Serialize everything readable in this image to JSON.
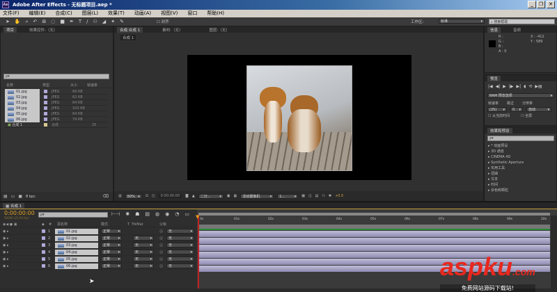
{
  "app": {
    "title": "Adobe After Effects - 无标题项目.aep *",
    "logo": "Ae",
    "min": "_",
    "max": "❐",
    "close": "✕"
  },
  "menu": [
    "文件(F)",
    "编辑(E)",
    "合成(C)",
    "图层(L)",
    "效果(T)",
    "动画(A)",
    "视图(V)",
    "窗口",
    "帮助(H)"
  ],
  "toolbar": {
    "snap_label": "对齐",
    "workspace_label": "工作区:",
    "workspace_value": "标准",
    "help_search": "搜索帮助"
  },
  "project": {
    "tab": "项目",
    "effects_tab": "效果控件:（无）",
    "search": "ρ▾",
    "columns": [
      "名称",
      "类型",
      "大小",
      "帧速率"
    ],
    "items": [
      {
        "name": "01.jpg",
        "type": "JPEG",
        "size": "69 KB"
      },
      {
        "name": "02.jpg",
        "type": "JPEG",
        "size": "62 KB"
      },
      {
        "name": "03.jpg",
        "type": "JPEG",
        "size": "64 KB"
      },
      {
        "name": "04.jpg",
        "type": "JPEG",
        "size": "103 KB"
      },
      {
        "name": "05.jpg",
        "type": "JPEG",
        "size": "64 KB"
      },
      {
        "name": "06.jpg",
        "type": "JPEG",
        "size": "74 KB"
      }
    ],
    "comp": {
      "name": "合成 1",
      "type": "合成",
      "fps": "25"
    },
    "bpc": "8 bpc"
  },
  "viewer": {
    "tabs": [
      "合成:合成 1",
      "素材:（无）",
      "图层:（无）"
    ],
    "subtab": "合成 1",
    "zoom": "50%",
    "timecode": "0:00:00:00",
    "resolution": "二分...",
    "camera": "活动摄像机",
    "views": "1...",
    "exposure": "+0.0"
  },
  "info": {
    "tabs": [
      "信息",
      "音频"
    ],
    "r": "R :",
    "g": "G :",
    "b": "B :",
    "a": "A : 0",
    "x": "X : -412",
    "y": "Y : 589"
  },
  "preview": {
    "tab": "预览",
    "ram": "RAM 预览选项",
    "fps_label": "帧速率",
    "skip_label": "跳过",
    "res_label": "分辨率",
    "fps": "(25)",
    "skip": "0",
    "res": "自动",
    "from_current": "从当前时间",
    "fullscreen": "全屏"
  },
  "effects": {
    "tab": "效果和预设",
    "search": "ρ▾",
    "items": [
      "* 动画预设",
      "3D 通道",
      "CINEMA 4D",
      "Synthetic Aperture",
      "实用工具",
      "扭曲",
      "文本",
      "时间",
      "杂色和颗粒"
    ]
  },
  "timeline": {
    "tab": "合成 1",
    "timecode": "0:00:00:00",
    "frame_info": "00000 (25.00 fps)",
    "search": "ρ▾",
    "headers": [
      "源名称",
      "模式",
      "T",
      "TrkMat",
      "父级"
    ],
    "layers": [
      {
        "num": "1",
        "name": "01.jpg",
        "mode": "正常",
        "trkmat": "",
        "parent": "无"
      },
      {
        "num": "2",
        "name": "02.jpg",
        "mode": "正常",
        "trkmat": "无",
        "parent": "无"
      },
      {
        "num": "3",
        "name": "03.jpg",
        "mode": "正常",
        "trkmat": "无",
        "parent": "无"
      },
      {
        "num": "4",
        "name": "04.jpg",
        "mode": "正常",
        "trkmat": "无",
        "parent": "无"
      },
      {
        "num": "5",
        "name": "05.jpg",
        "mode": "正常",
        "trkmat": "无",
        "parent": "无"
      },
      {
        "num": "6",
        "name": "06.jpg",
        "mode": "正常",
        "trkmat": "无",
        "parent": "无"
      }
    ],
    "ruler": [
      "0s",
      "01s",
      "02s",
      "03s",
      "04s",
      "05s",
      "06s",
      "07s",
      "08s",
      "09s",
      "10s"
    ]
  },
  "watermark": {
    "brand": "aspku",
    "tld": ".com",
    "tagline": "免费网站源码下载站!"
  }
}
